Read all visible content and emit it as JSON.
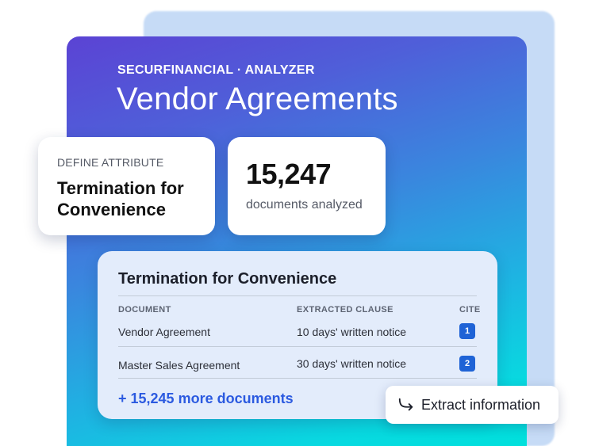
{
  "header": {
    "eyebrow": "SECURFINANCIAL · ANALYZER",
    "title": "Vendor Agreements"
  },
  "attribute_card": {
    "label": "DEFINE ATTRIBUTE",
    "value": "Termination for Convenience"
  },
  "count_card": {
    "value": "15,247",
    "label": "documents analyzed"
  },
  "results": {
    "title": "Termination for Convenience",
    "columns": {
      "document": "DOCUMENT",
      "clause": "EXTRACTED CLAUSE",
      "cite": "CITE"
    },
    "rows": [
      {
        "document": "Vendor Agreement",
        "clause": "10 days' written notice",
        "cite": "1"
      },
      {
        "document": "Master Sales Agreement",
        "clause": "30 days' written notice",
        "cite": "2"
      }
    ],
    "more_link": "+ 15,245 more documents"
  },
  "actions": {
    "extract_label": "Extract information",
    "extract_icon": "curved-arrow-right-icon"
  },
  "colors": {
    "gradient_top": "#5b43d4",
    "gradient_bottom": "#00e0dc",
    "accent_blue": "#2b5ae0",
    "badge_blue": "#1f63d6",
    "back_card": "#c6dbf6",
    "table_bg": "#e3ecfb"
  }
}
